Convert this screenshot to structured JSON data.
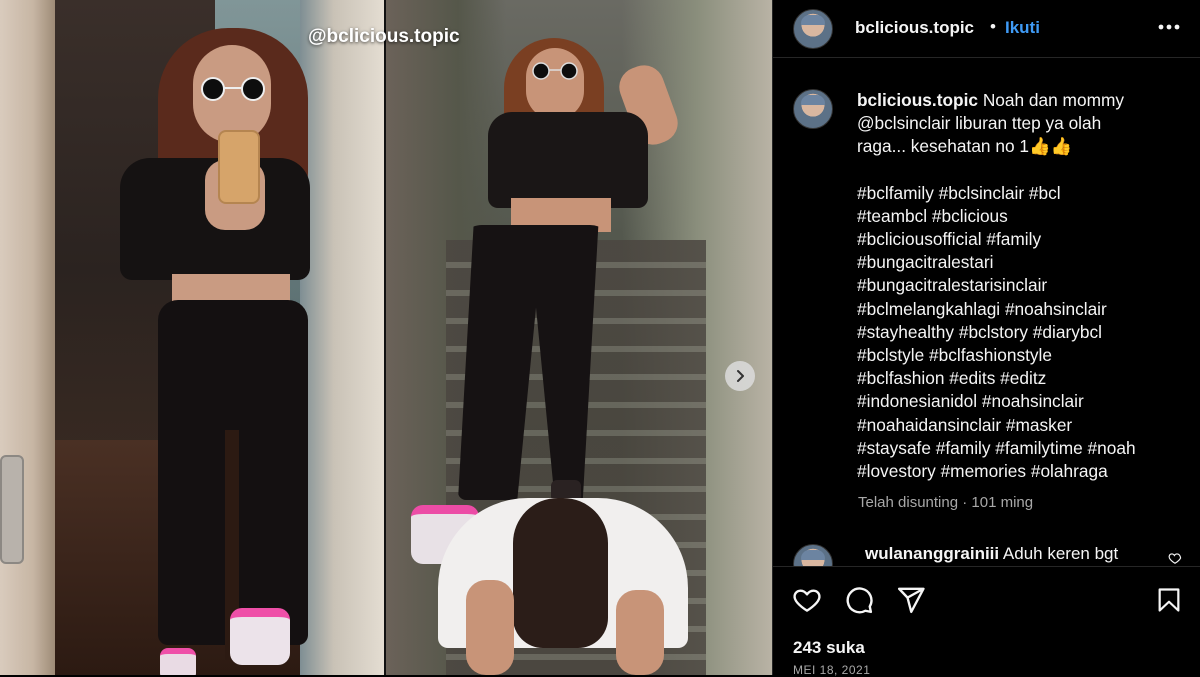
{
  "media": {
    "watermark": "@bclicious.topic",
    "next_icon": "chevron-right-icon"
  },
  "header": {
    "username": "bclicious.topic",
    "separator": "•",
    "follow_label": "Ikuti",
    "more_icon": "more-horizontal-icon"
  },
  "caption": {
    "username": "bclicious.topic",
    "lines": [
      "Noah dan mommy",
      "@bclsinclair liburan ttep ya olah",
      "raga... kesehatan no 1👍👍",
      "",
      "#bclfamily #bclsinclair #bcl",
      "#teambcl #bclicious",
      "#bcliciousofficial #family",
      "#bungacitralestari",
      "#bungacitralestarisinclair",
      "#bclmelangkahlagi #noahsinclair",
      "#stayhealthy #bclstory #diarybcl",
      "#bclstyle #bclfashionstyle",
      "#bclfashion #edits #editz",
      "#indonesianidol #noahsinclair",
      "#noahaidansinclair #masker",
      "#staysafe #family #familytime #noah",
      "#lovestory #memories #olahraga"
    ],
    "meta": "Telah disunting · 101 ming"
  },
  "comment": {
    "username": "wulananggrainiii",
    "text": "Aduh keren bgt"
  },
  "actions": {
    "like_icon": "heart-icon",
    "comment_icon": "comment-icon",
    "share_icon": "share-icon",
    "save_icon": "bookmark-icon",
    "likes": "243 suka",
    "date": "MEI 18, 2021"
  },
  "colors": {
    "background": "#000000",
    "text": "#f5f5f5",
    "muted": "#a8a8a8",
    "accent": "#3f9bf6",
    "divider": "#262626"
  }
}
